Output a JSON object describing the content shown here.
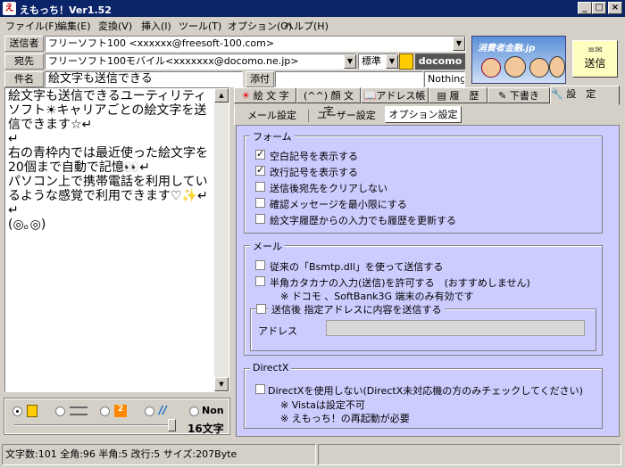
{
  "window": {
    "title": "えもっち！Ver1.52"
  },
  "menu": [
    "ファイル(F)",
    "編集(E)",
    "変換(V)",
    "挿入(I)",
    "ツール(T)",
    "オプション(O)",
    "ヘルプ(H)"
  ],
  "header": {
    "from_label": "送信者",
    "from_value": "フリーソフト100 <xxxxxx@freesoft-100.com>",
    "to_label": "宛先",
    "to_value": "フリーソフト100モバイル<xxxxxxx@docomo.ne.jp>",
    "mode_value": "標準",
    "carrier_value": "docomo",
    "subject_label": "件名",
    "subject_value": "絵文字も送信できる",
    "attach_label": "添付",
    "attach_value": "Nothing",
    "banner_text": "消費者金融.jp",
    "send_label": "送信"
  },
  "editor": {
    "text": "絵文字も送信できるユーティリティソフト☀キャリアごとの絵文字を送信できます☆↵\n↵\n右の青枠内では最近使った絵文字を20個まで自動で記憶👀↵\nパソコン上で携帯電話を利用しているような感覚で利用できます♡✨↵\n↵\n(◎｡◎)"
  },
  "bottom_left": {
    "radios": [
      {
        "label": "",
        "icon": "docomo-icon",
        "selected": true
      },
      {
        "label": "",
        "icon": "au-icon",
        "selected": false
      },
      {
        "label": "",
        "icon": "softbank-icon",
        "selected": false
      },
      {
        "label": "",
        "icon": "willcom-icon",
        "selected": false
      },
      {
        "label": "Non",
        "icon": "",
        "selected": false
      }
    ],
    "count_label": "16文字"
  },
  "main_tabs": [
    "絵 文 字",
    "(^^) 顔 文 字",
    "アドレス帳",
    "履　歴",
    "下書き",
    "設　定"
  ],
  "sub_tabs": [
    "メール設定",
    "ユーザー設定",
    "オプション設定"
  ],
  "form_group": {
    "title": "フォーム",
    "options": [
      {
        "label": "空白記号を表示する",
        "checked": true
      },
      {
        "label": "改行記号を表示する",
        "checked": true
      },
      {
        "label": "送信後宛先をクリアしない",
        "checked": false
      },
      {
        "label": "確認メッセージを最小限にする",
        "checked": false
      },
      {
        "label": "絵文字履歴からの入力でも履歴を更新する",
        "checked": false
      }
    ]
  },
  "mail_group": {
    "title": "メール",
    "opt1": "従来の「Bsmtp.dll」を使って送信する",
    "opt2": "半角カタカナの入力(送信)を許可する　(おすすめしません)",
    "opt2_note": "※ ドコモ 、SoftBank3G 端末のみ有効です",
    "opt3": "送信後 指定アドレスに内容を送信する",
    "address_label": "アドレス",
    "address_value": ""
  },
  "directx_group": {
    "title": "DirectX",
    "opt1": "DirectXを使用しない(DirectX未対応機の方のみチェックしてください)",
    "note1": "※ Vistaは設定不可",
    "note2": "※ えもっち！の再起動が必要"
  },
  "status": {
    "text": "文字数:101 全角:96 半角:5 改行:5 サイズ:207Byte"
  }
}
